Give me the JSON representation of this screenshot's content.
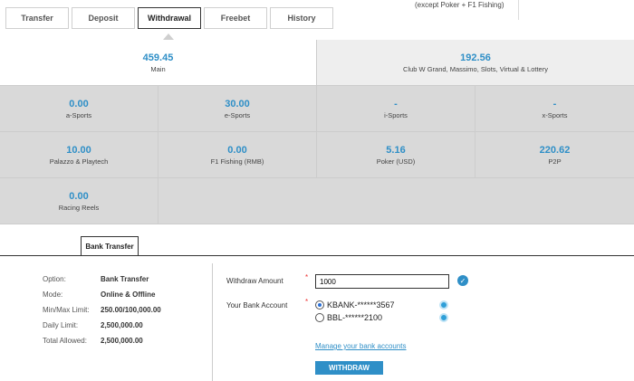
{
  "tabs": [
    "Transfer",
    "Deposit",
    "Withdrawal",
    "Freebet",
    "History"
  ],
  "note": "(except Poker + F1 Fishing)",
  "wallets_top": [
    {
      "value": "459.45",
      "label": "Main"
    },
    {
      "value": "192.56",
      "label": "Club W Grand, Massimo, Slots, Virtual & Lottery"
    }
  ],
  "wallets_row2": [
    {
      "value": "0.00",
      "label": "a-Sports"
    },
    {
      "value": "30.00",
      "label": "e-Sports"
    },
    {
      "value": "-",
      "label": "i-Sports"
    },
    {
      "value": "-",
      "label": "x-Sports"
    }
  ],
  "wallets_row3": [
    {
      "value": "10.00",
      "label": "Palazzo & Playtech"
    },
    {
      "value": "0.00",
      "label": "F1 Fishing (RMB)"
    },
    {
      "value": "5.16",
      "label": "Poker (USD)"
    },
    {
      "value": "220.62",
      "label": "P2P"
    }
  ],
  "wallets_row4": [
    {
      "value": "0.00",
      "label": "Racing Reels"
    }
  ],
  "subtab": "Bank Transfer",
  "info": [
    {
      "k": "Option:",
      "v": "Bank Transfer"
    },
    {
      "k": "Mode:",
      "v": "Online & Offline"
    },
    {
      "k": "Min/Max Limit:",
      "v": "250.00/100,000.00"
    },
    {
      "k": "Daily Limit:",
      "v": "2,500,000.00"
    },
    {
      "k": "Total Allowed:",
      "v": "2,500,000.00"
    }
  ],
  "form": {
    "amount_label": "Withdraw Amount",
    "amount_value": "1000",
    "account_label": "Your Bank Account",
    "star": "*",
    "accounts": [
      "KBANK-******3567",
      "BBL-******2100"
    ],
    "manage_link": "Manage your bank accounts",
    "withdraw_button": "WITHDRAW"
  },
  "colors": {
    "accent": "#2f8fc7",
    "panel": "#d9d9d9"
  }
}
